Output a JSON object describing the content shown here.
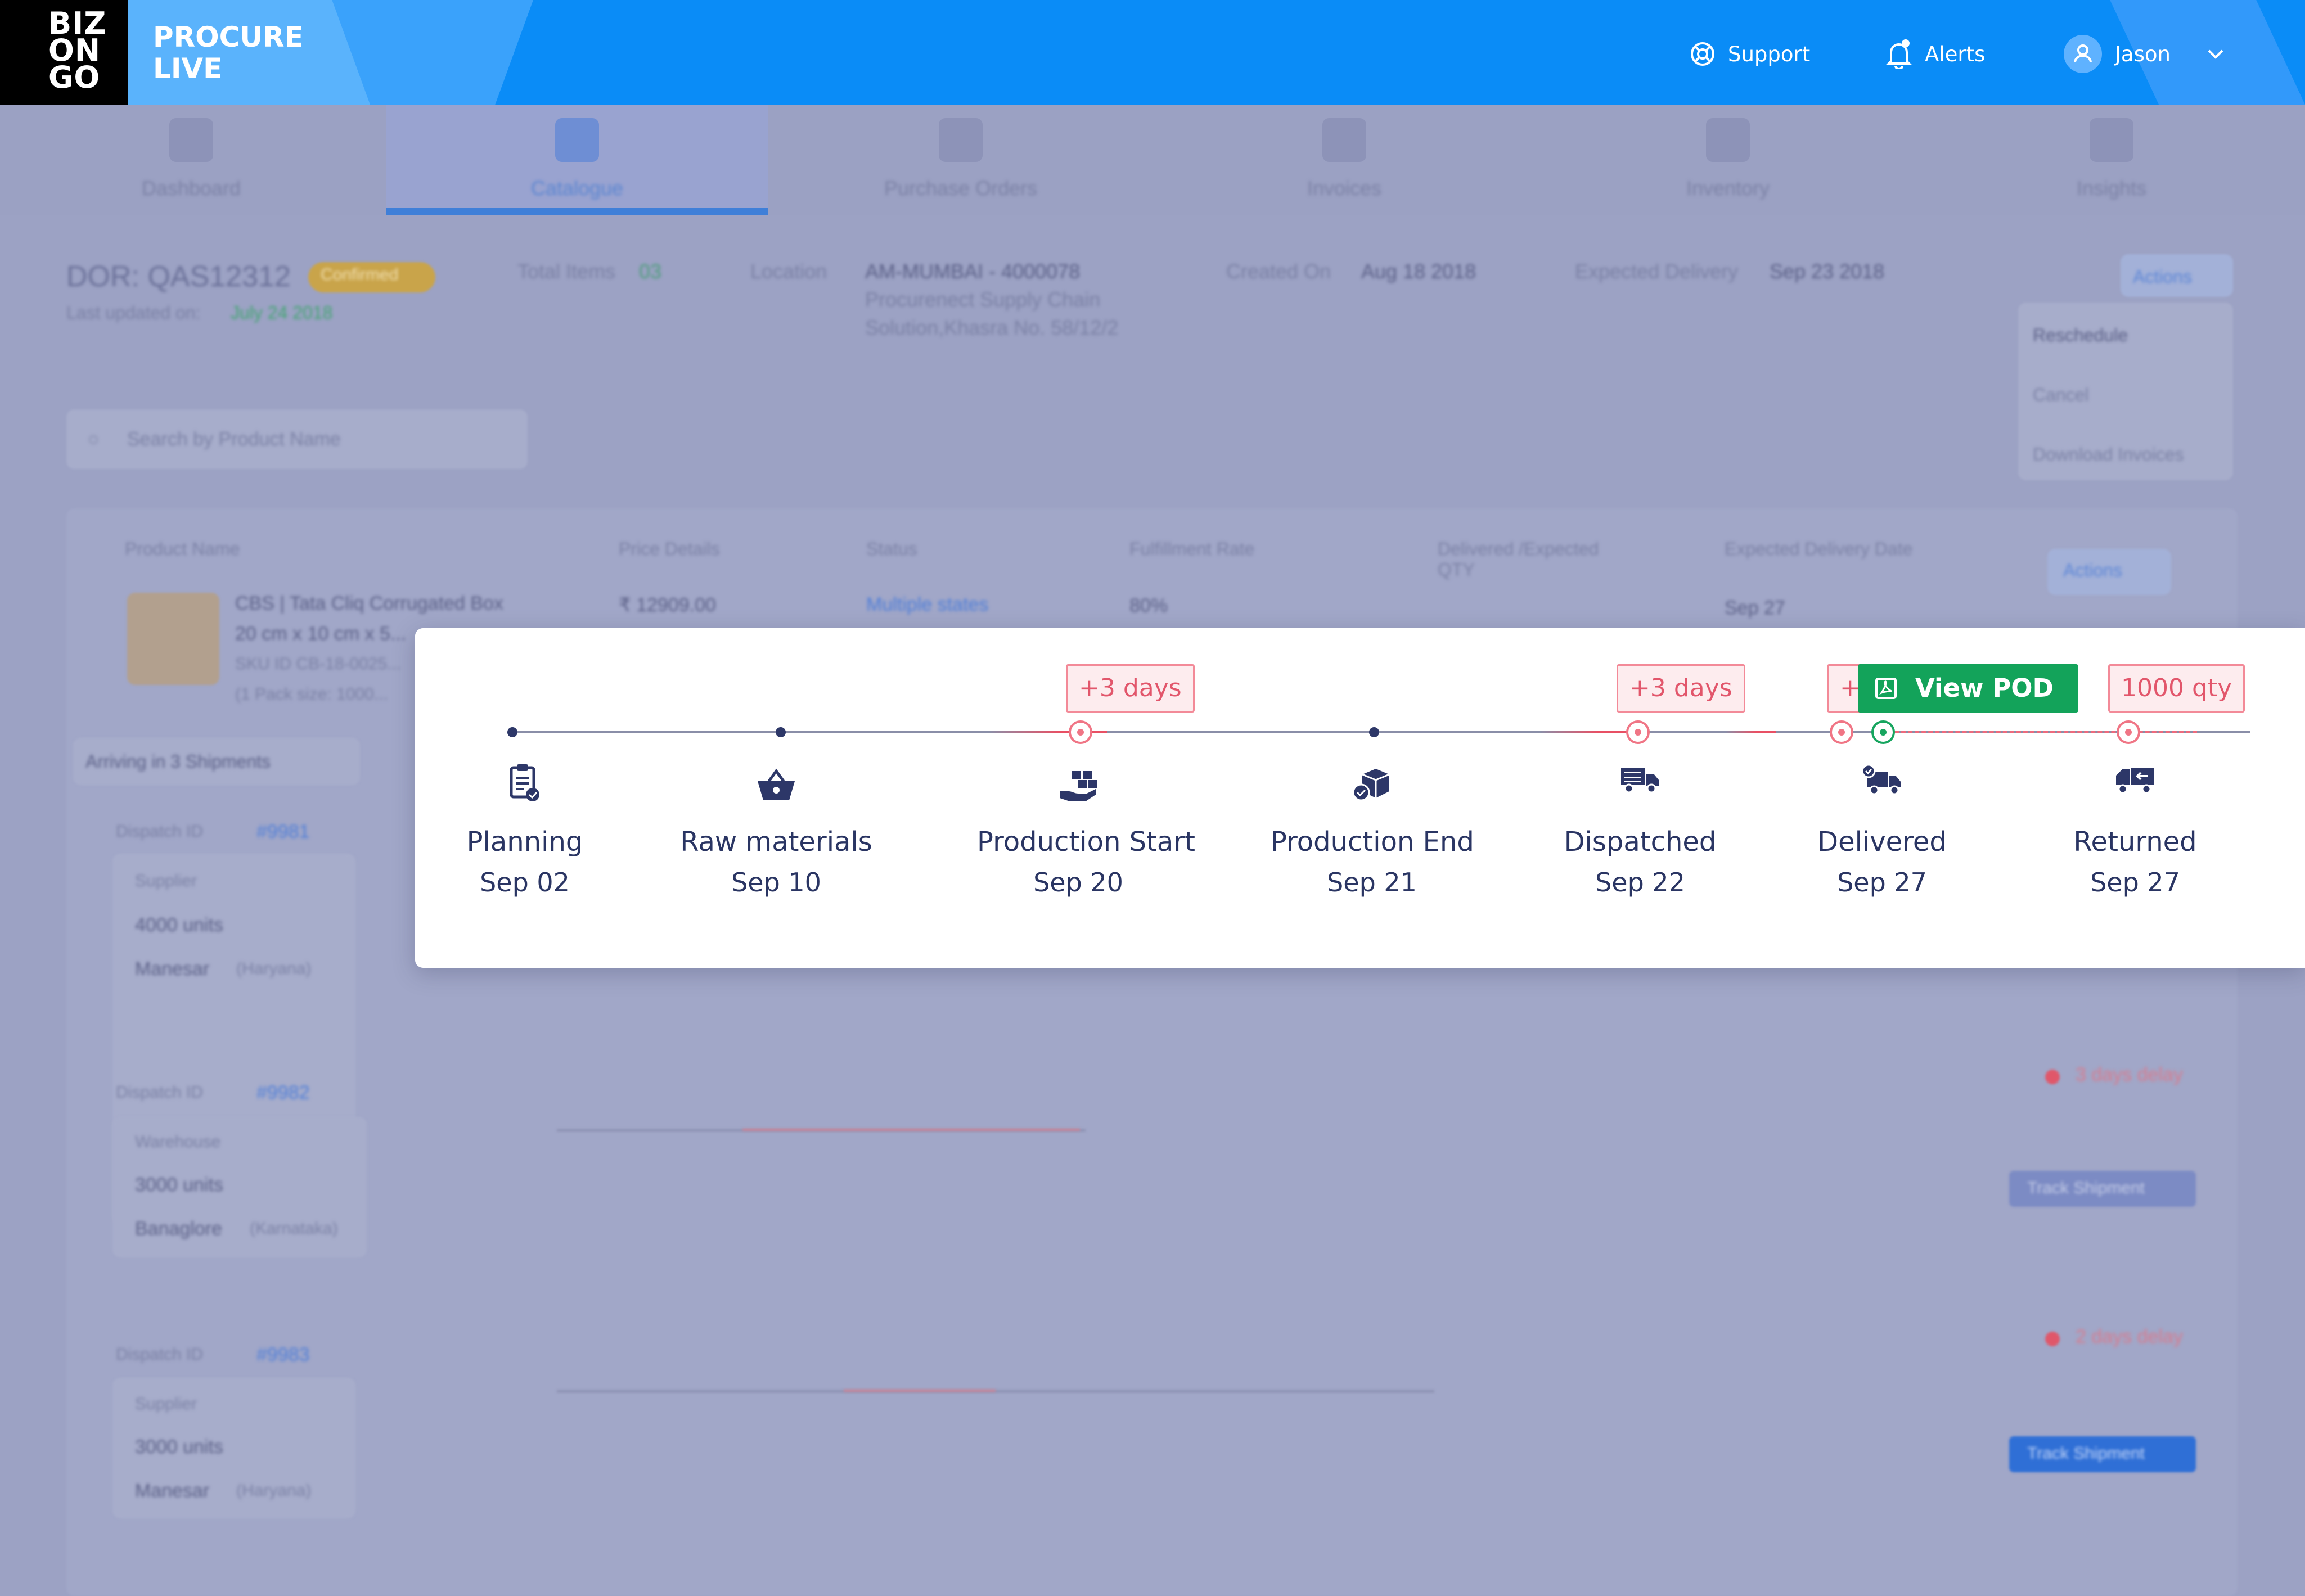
{
  "header": {
    "logo_lines": [
      "BIZ",
      "ON",
      "GO"
    ],
    "brand_line1": "PROCURE",
    "brand_line2": "LIVE",
    "support_label": "Support",
    "alerts_label": "Alerts",
    "user_name": "Jason"
  },
  "tabs": [
    {
      "label": "Dashboard",
      "active": false
    },
    {
      "label": "Catalogue",
      "active": true
    },
    {
      "label": "Purchase Orders",
      "active": false
    },
    {
      "label": "Invoices",
      "active": false
    },
    {
      "label": "Inventory",
      "active": false
    },
    {
      "label": "Insights",
      "active": false
    }
  ],
  "order": {
    "id": "DOR: QAS12312",
    "status_badge": "Confirmed",
    "last_updated_label": "Last updated on:",
    "last_updated_value": "July 24 2018",
    "total_items_label": "Total Items",
    "total_items_value": "03",
    "location_label": "Location",
    "location_value": "AM-MUMBAI - 4000078",
    "location_line2": "Procurenect Supply Chain",
    "location_line3": "Solution,Khasra No. 58/12/2",
    "created_label": "Created On",
    "created_value": "Aug 18 2018",
    "expected_label": "Expected Delivery",
    "expected_value": "Sep 23 2018",
    "actions_label": "Actions",
    "actions_menu": [
      "Reschedule",
      "Cancel",
      "Download Invoices"
    ]
  },
  "search": {
    "placeholder": "Search by Product Name"
  },
  "product_table": {
    "headers": [
      "Product Name",
      "Price Details",
      "Status",
      "Fulfillment Rate",
      "Delivered /Expected QTY",
      "Expected Delivery Date"
    ],
    "product_name": "CBS | Tata Cliq Corrugated Box",
    "product_dims": "20 cm x 10 cm x 5...",
    "sku": "SKU ID CB-18-0025...",
    "pack": "(1 Pack size: 1000...",
    "price": "₹ 12909.00",
    "status": "Multiple states",
    "fulfillment": "80%",
    "delivery_date": "Sep 27",
    "actions_label": "Actions",
    "arriving": "Arriving in 3 Shipments"
  },
  "shipments": [
    {
      "dispatch_label": "Dispatch ID",
      "dispatch_id": "#9981",
      "source": "Supplier",
      "units": "4000 units",
      "city": "Manesar",
      "state": "(Haryana)"
    },
    {
      "dispatch_label": "Dispatch ID",
      "dispatch_id": "#9982",
      "source": "Warehouse",
      "units": "3000 units",
      "city": "Banaglore",
      "state": "(Karnataka)",
      "delay": "3 days delay",
      "button": "Track Shipment"
    },
    {
      "dispatch_label": "Dispatch ID",
      "dispatch_id": "#9983",
      "source": "Supplier",
      "units": "3000 units",
      "city": "Manesar",
      "state": "(Haryana)",
      "delay": "2 days delay",
      "button": "Track Shipment"
    }
  ],
  "timeline": {
    "view_pod_label": "View POD",
    "steps": [
      {
        "name": "Planning",
        "date": "Sep 02",
        "icon": "clipboard-check-icon"
      },
      {
        "name": "Raw materials",
        "date": "Sep 10",
        "icon": "basket-icon"
      },
      {
        "name": "Production Start",
        "date": "Sep 20",
        "icon": "factory-hand-icon",
        "tag": "+3 days"
      },
      {
        "name": "Production End",
        "date": "Sep 21",
        "icon": "box-check-icon"
      },
      {
        "name": "Dispatched",
        "date": "Sep 22",
        "icon": "truck-icon",
        "tag": "+3 days"
      },
      {
        "name": "Delivered",
        "date": "Sep 27",
        "icon": "truck-delivered-icon",
        "tag": "+"
      },
      {
        "name": "Returned",
        "date": "Sep 27",
        "icon": "truck-return-icon",
        "tag": "1000 qty"
      }
    ]
  },
  "colors": {
    "topbar": "#0a8cf7",
    "delay_red": "#e2566b",
    "pod_green": "#13a35a",
    "text_navy": "#2a3563"
  }
}
